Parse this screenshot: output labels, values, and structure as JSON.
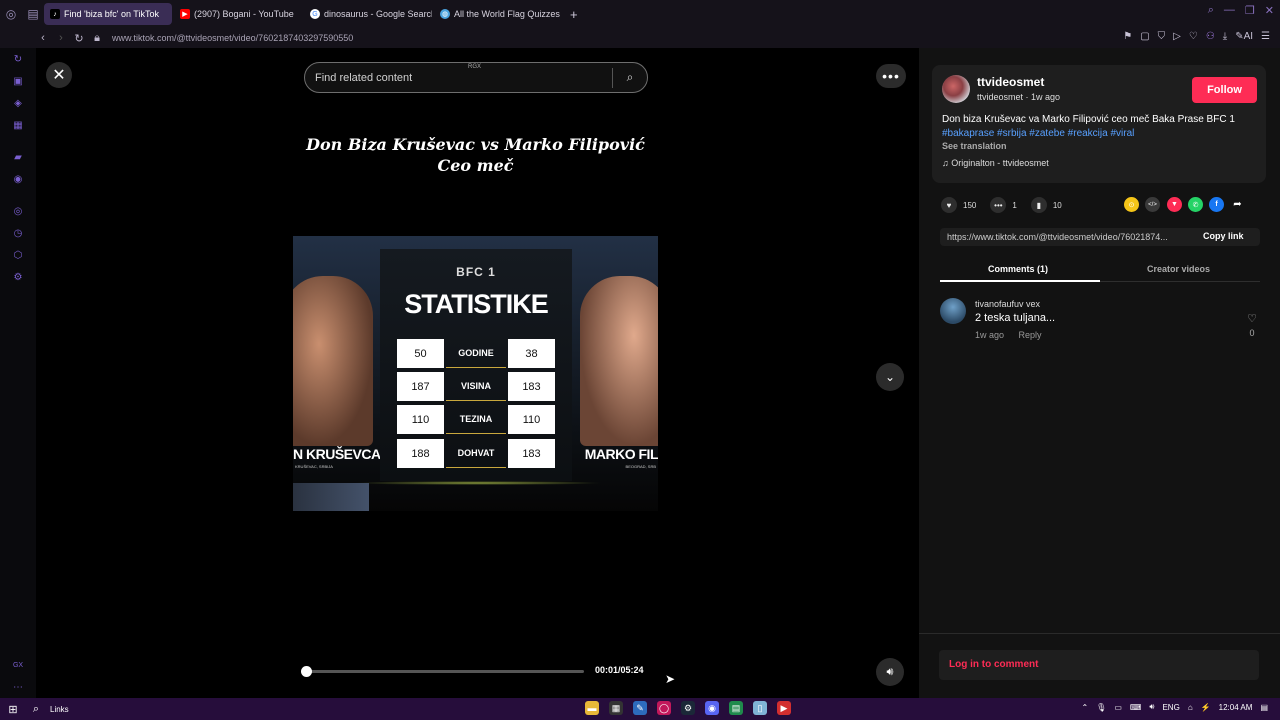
{
  "browser": {
    "tabs": [
      {
        "label": "Find 'biza bfc' on TikTok",
        "icon": "tiktok-icon",
        "active": true
      },
      {
        "label": "(2907) Bogani - YouTube",
        "icon": "youtube-icon",
        "active": false
      },
      {
        "label": "dinosaurus - Google Search",
        "icon": "google-icon",
        "active": false
      },
      {
        "label": "All the World Flag Quizzes",
        "icon": "globe-icon",
        "active": false
      }
    ],
    "url": "www.tiktok.com/@ttvideosmet/video/7602187403297590550"
  },
  "search": {
    "placeholder": "Find related content",
    "badge": "RGX"
  },
  "video": {
    "title_line1": "Don Biza Kruševac vs Marko Filipović",
    "title_line2": "Ceo meč",
    "time": "00:01/05:24",
    "progress_fraction": 0.003
  },
  "poster": {
    "brand": "BFC 1",
    "heading": "STATISTIKE",
    "fighter_left": "N KRUŠEVCA",
    "fighter_left_sub": "KRUŠEVAC, SRBIJA",
    "fighter_right": "MARKO FIL",
    "fighter_right_sub": "BEOGRAD, SRB",
    "stats": [
      {
        "left": "50",
        "label": "GODINE",
        "right": "38"
      },
      {
        "left": "187",
        "label": "VISINA",
        "right": "183"
      },
      {
        "left": "110",
        "label": "TEZINA",
        "right": "110"
      },
      {
        "left": "188",
        "label": "DOHVAT",
        "right": "183"
      }
    ]
  },
  "author": {
    "name": "ttvideosmet",
    "sub": "ttvideosmet · 1w ago",
    "follow_label": "Follow"
  },
  "description": {
    "text": "Don biza Kruševac va Marko Filipović ceo meč Baka Prase BFC 1",
    "tags": [
      "#bakaprase",
      "#srbija",
      "#zatebe",
      "#reakcija",
      "#viral"
    ],
    "see_translation": "See translation",
    "music": "Originalton - ttvideosmet"
  },
  "stats": {
    "likes": "150",
    "comments": "1",
    "saves": "10"
  },
  "share_icons": [
    {
      "name": "coin-share-icon",
      "color": "#f5c518",
      "glyph": "⊙"
    },
    {
      "name": "embed-share-icon",
      "color": "#3a3a3a",
      "glyph": "</>"
    },
    {
      "name": "direct-send-icon",
      "color": "#fe2c55",
      "glyph": "▼"
    },
    {
      "name": "whatsapp-share-icon",
      "color": "#25d366",
      "glyph": "✆"
    },
    {
      "name": "facebook-share-icon",
      "color": "#1877f2",
      "glyph": "f"
    }
  ],
  "link": {
    "url": "https://www.tiktok.com/@ttvideosmet/video/76021874...",
    "copy_label": "Copy link"
  },
  "panel_tabs": {
    "comments": "Comments (1)",
    "creator": "Creator videos"
  },
  "comment": {
    "user": "tivanofaufuv vex",
    "text": "2 teska tuljana...",
    "time": "1w ago",
    "reply": "Reply",
    "likes": "0"
  },
  "login_prompt": "Log in to comment",
  "taskbar": {
    "links_label": "Links",
    "lang": "ENG",
    "clock": "12:04 AM"
  }
}
